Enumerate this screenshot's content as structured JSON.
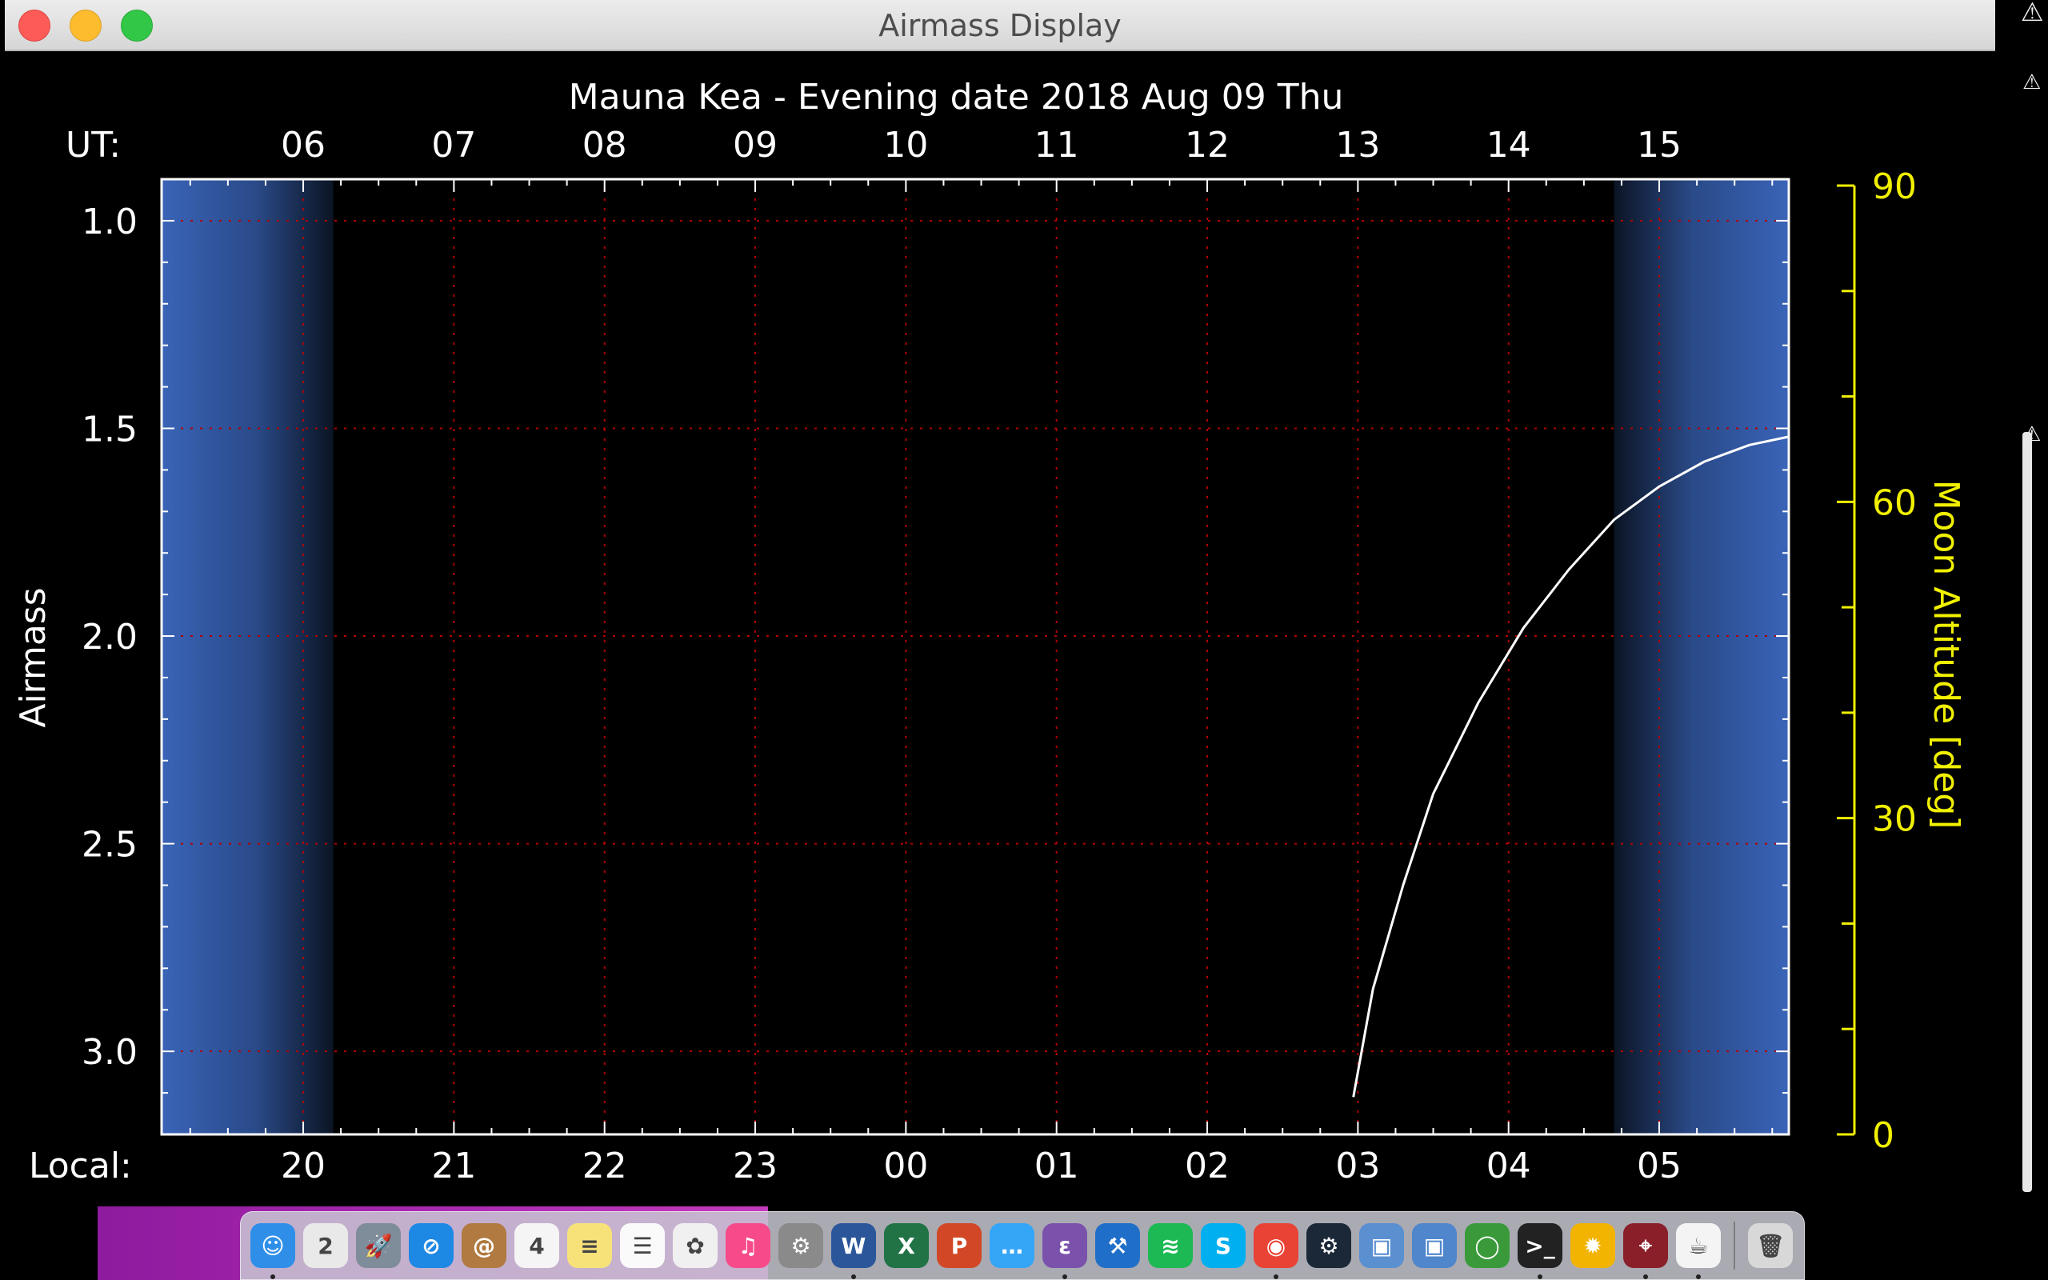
{
  "window": {
    "title": "Airmass Display"
  },
  "chart_data": {
    "type": "line",
    "title": "Mauna Kea - Evening date 2018 Aug 09  Thu",
    "top_axis_label": "UT:",
    "ut_ticks": [
      "06",
      "07",
      "08",
      "09",
      "10",
      "11",
      "12",
      "13",
      "14",
      "15"
    ],
    "bottom_axis_label": "Local:",
    "local_ticks": [
      "20",
      "21",
      "22",
      "23",
      "00",
      "01",
      "02",
      "03",
      "04",
      "05"
    ],
    "ylabel": "Airmass",
    "y_ticks": [
      "1.0",
      "1.5",
      "2.0",
      "2.5",
      "3.0"
    ],
    "ylim": [
      0.9,
      3.2
    ],
    "xlim_ut_hours": [
      5.06,
      15.86
    ],
    "y2label": "Moon Altitude [deg]",
    "y2_ticks": [
      "0",
      "30",
      "60",
      "90"
    ],
    "y2lim": [
      0,
      90
    ],
    "twilight": {
      "evening_end_ut_hour": 6.2,
      "morning_start_ut_hour": 14.7
    },
    "series": [
      {
        "color": "#ffffff",
        "points": [
          [
            12.97,
            3.11
          ],
          [
            13.1,
            2.85
          ],
          [
            13.3,
            2.6
          ],
          [
            13.5,
            2.38
          ],
          [
            13.8,
            2.16
          ],
          [
            14.1,
            1.98
          ],
          [
            14.4,
            1.84
          ],
          [
            14.7,
            1.72
          ],
          [
            15.0,
            1.64
          ],
          [
            15.3,
            1.58
          ],
          [
            15.6,
            1.54
          ],
          [
            15.86,
            1.52
          ]
        ]
      }
    ],
    "grid": true,
    "colors": {
      "axis": "#ffffff",
      "moon_axis": "#f0f000",
      "grid": "#b40000",
      "twilight_blue": "#3a64b8",
      "curve": "#ffffff"
    }
  },
  "dock": {
    "items": [
      {
        "icon": "finder-icon",
        "glyph": "☺",
        "bg": "#2f8fe8",
        "running": true
      },
      {
        "icon": "number2-app-icon",
        "glyph": "2",
        "bg": "#e9e9e9",
        "running": false
      },
      {
        "icon": "launchpad-icon",
        "glyph": "🚀",
        "bg": "#7f8c99",
        "running": false
      },
      {
        "icon": "safari-icon",
        "glyph": "⊘",
        "bg": "#1e88e5",
        "running": false
      },
      {
        "icon": "contacts-icon",
        "glyph": "@",
        "bg": "#b07a40",
        "running": false
      },
      {
        "icon": "calendar-icon",
        "glyph": "4",
        "bg": "#f5f5f5",
        "running": false
      },
      {
        "icon": "notes-icon",
        "glyph": "≡",
        "bg": "#f7e27a",
        "running": false
      },
      {
        "icon": "reminders-icon",
        "glyph": "☰",
        "bg": "#fafafa",
        "running": false
      },
      {
        "icon": "photos-icon",
        "glyph": "✿",
        "bg": "#f0f0f0",
        "running": false
      },
      {
        "icon": "itunes-icon",
        "glyph": "♫",
        "bg": "#f64a8a",
        "running": false
      },
      {
        "icon": "system-preferences-icon",
        "glyph": "⚙",
        "bg": "#8a8a8a",
        "running": false
      },
      {
        "icon": "word-icon",
        "glyph": "W",
        "bg": "#2b579a",
        "running": true
      },
      {
        "icon": "excel-icon",
        "glyph": "X",
        "bg": "#217346",
        "running": false
      },
      {
        "icon": "powerpoint-icon",
        "glyph": "P",
        "bg": "#d24726",
        "running": false
      },
      {
        "icon": "messages-icon",
        "glyph": "…",
        "bg": "#35a6f5",
        "running": false
      },
      {
        "icon": "emacs-icon",
        "glyph": "ε",
        "bg": "#7b52ab",
        "running": true
      },
      {
        "icon": "xcode-icon",
        "glyph": "⚒",
        "bg": "#1f6fc9",
        "running": false
      },
      {
        "icon": "spotify-icon",
        "glyph": "≋",
        "bg": "#1db954",
        "running": false
      },
      {
        "icon": "skype-icon",
        "glyph": "S",
        "bg": "#00aff0",
        "running": false
      },
      {
        "icon": "chrome-icon",
        "glyph": "◉",
        "bg": "#e84335",
        "running": true
      },
      {
        "icon": "steam-icon",
        "glyph": "⚙",
        "bg": "#1b2838",
        "running": false
      },
      {
        "icon": "virtualbox-icon",
        "glyph": "▣",
        "bg": "#5a8fd0",
        "running": false
      },
      {
        "icon": "virtualbox-vm-icon",
        "glyph": "▣",
        "bg": "#4f86cc",
        "running": false
      },
      {
        "icon": "sync-app-icon",
        "glyph": "◯",
        "bg": "#3a9a3a",
        "running": false
      },
      {
        "icon": "terminal-icon",
        "glyph": ">_",
        "bg": "#222222",
        "running": true
      },
      {
        "icon": "stellarium-icon",
        "glyph": "✹",
        "bg": "#f2b400",
        "running": false
      },
      {
        "icon": "telescope-app-icon",
        "glyph": "⌖",
        "bg": "#8a1f2a",
        "running": true
      },
      {
        "icon": "java-icon",
        "glyph": "☕",
        "bg": "#f4f4f4",
        "running": true
      }
    ],
    "trash": {
      "icon": "trash-icon",
      "glyph": "🗑",
      "bg": "#d8d8d8"
    }
  }
}
